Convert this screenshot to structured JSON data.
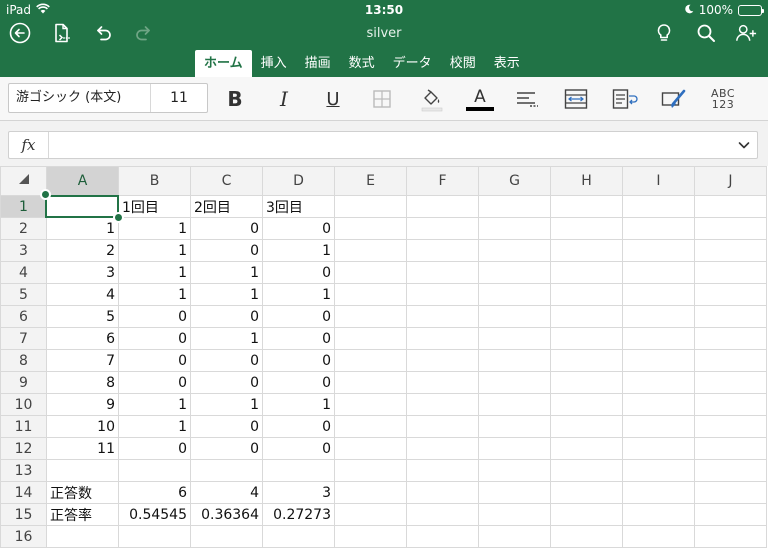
{
  "status_bar": {
    "device": "iPad",
    "time": "13:50",
    "battery": "100%"
  },
  "header": {
    "doc_title": "silver"
  },
  "tabs": [
    {
      "label": "ホーム",
      "active": true
    },
    {
      "label": "挿入",
      "active": false
    },
    {
      "label": "描画",
      "active": false
    },
    {
      "label": "数式",
      "active": false
    },
    {
      "label": "データ",
      "active": false
    },
    {
      "label": "校閲",
      "active": false
    },
    {
      "label": "表示",
      "active": false
    }
  ],
  "ribbon": {
    "font_name": "游ゴシック (本文)",
    "font_size": "11",
    "bold_label": "B",
    "italic_label": "I",
    "underline_label": "U",
    "font_color_label": "A",
    "font_color": "#000000",
    "number_format_top": "ABC",
    "number_format_bottom": "123"
  },
  "formula_bar": {
    "fx_label": "fx",
    "value": ""
  },
  "sheet": {
    "columns": [
      "A",
      "B",
      "C",
      "D",
      "E",
      "F",
      "G",
      "H",
      "I",
      "J"
    ],
    "selected_column": "A",
    "selected_row": "1",
    "rows": [
      {
        "n": "1",
        "cells": [
          "",
          "1回目",
          "2回目",
          "3回目"
        ]
      },
      {
        "n": "2",
        "cells": [
          "1",
          "1",
          "0",
          "0"
        ]
      },
      {
        "n": "3",
        "cells": [
          "2",
          "1",
          "0",
          "1"
        ]
      },
      {
        "n": "4",
        "cells": [
          "3",
          "1",
          "1",
          "0"
        ]
      },
      {
        "n": "5",
        "cells": [
          "4",
          "1",
          "1",
          "1"
        ]
      },
      {
        "n": "6",
        "cells": [
          "5",
          "0",
          "0",
          "0"
        ]
      },
      {
        "n": "7",
        "cells": [
          "6",
          "0",
          "1",
          "0"
        ]
      },
      {
        "n": "8",
        "cells": [
          "7",
          "0",
          "0",
          "0"
        ]
      },
      {
        "n": "9",
        "cells": [
          "8",
          "0",
          "0",
          "0"
        ]
      },
      {
        "n": "10",
        "cells": [
          "9",
          "1",
          "1",
          "1"
        ]
      },
      {
        "n": "11",
        "cells": [
          "10",
          "1",
          "0",
          "0"
        ]
      },
      {
        "n": "12",
        "cells": [
          "11",
          "0",
          "0",
          "0"
        ]
      },
      {
        "n": "13",
        "cells": [
          "",
          "",
          "",
          ""
        ]
      },
      {
        "n": "14",
        "cells": [
          "正答数",
          "6",
          "4",
          "3"
        ]
      },
      {
        "n": "15",
        "cells": [
          "正答率",
          "0.54545",
          "0.36364",
          "0.27273"
        ]
      },
      {
        "n": "16",
        "cells": [
          "",
          "",
          "",
          ""
        ]
      }
    ]
  },
  "colors": {
    "accent": "#217346",
    "grid_line": "#d9d9d9",
    "header_bg": "#f3f3f3"
  }
}
